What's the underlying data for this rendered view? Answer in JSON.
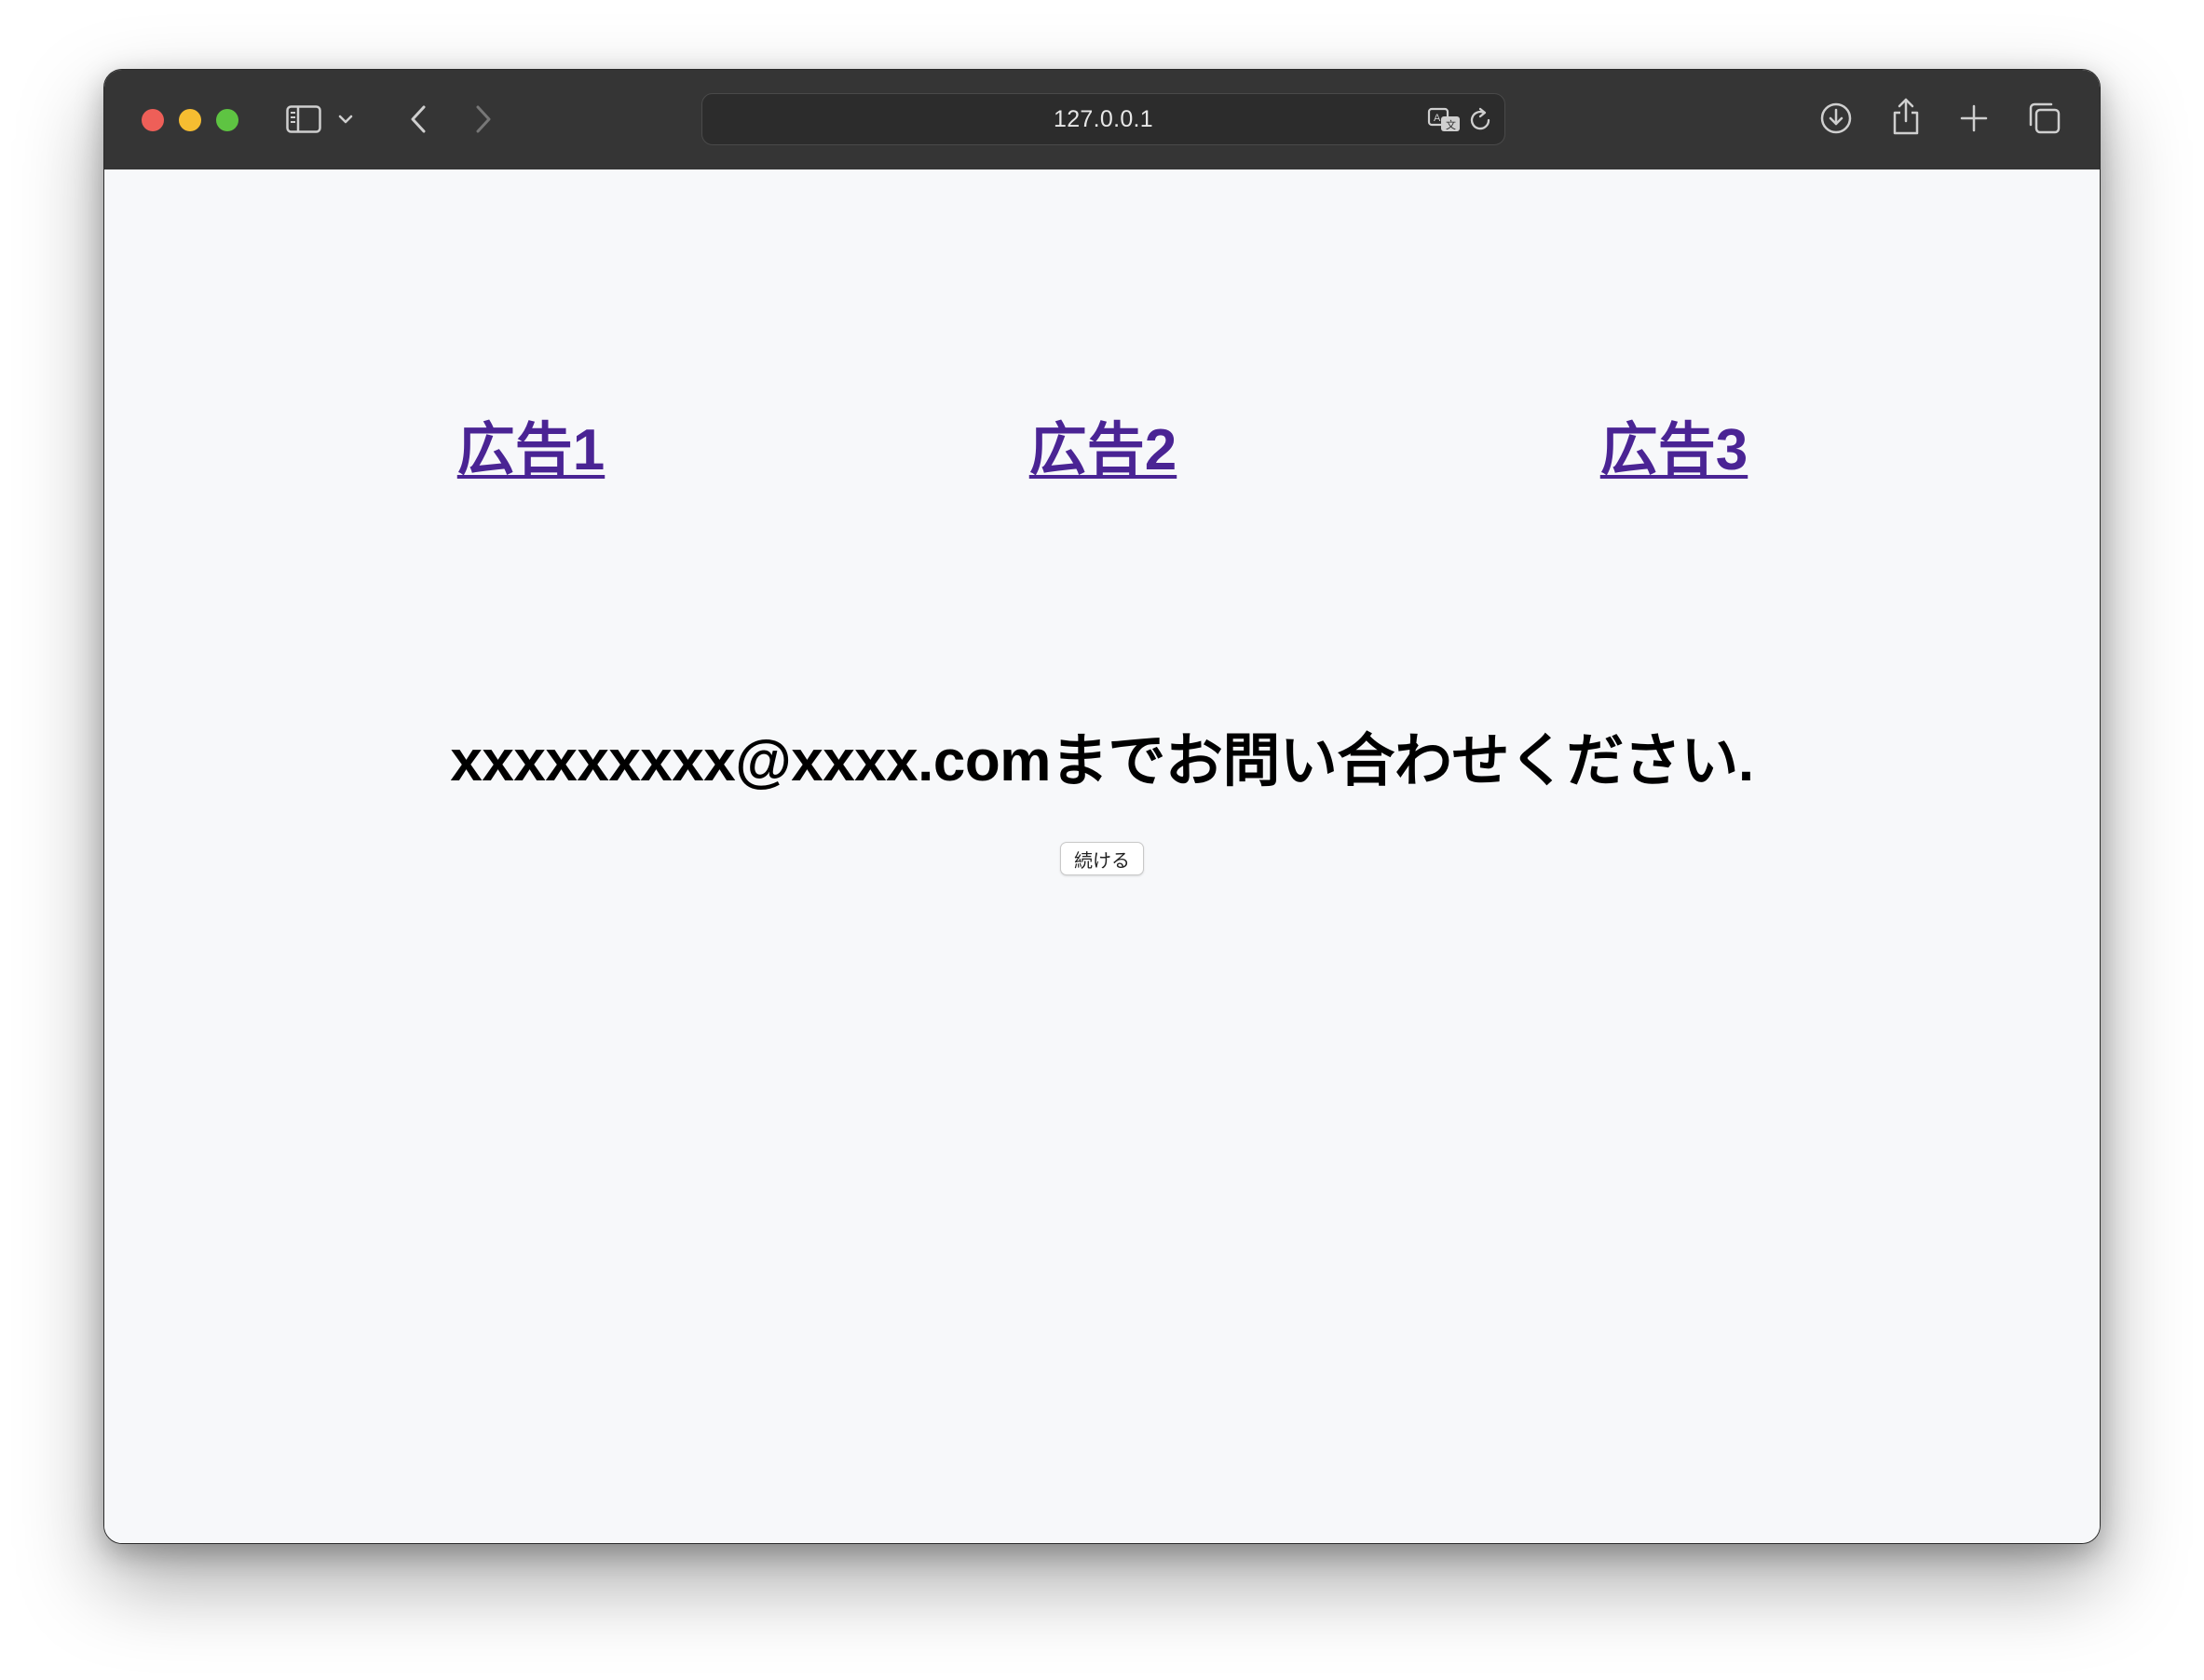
{
  "browser": {
    "url": "127.0.0.1",
    "icons": {
      "sidebar": "sidebar-icon",
      "tab_group_menu": "chevron-down-icon",
      "back": "chevron-left-icon",
      "forward": "chevron-right-icon",
      "translate": "translate-icon",
      "reload": "reload-icon",
      "downloads": "download-icon",
      "share": "share-icon",
      "new_tab": "plus-icon",
      "tab_overview": "tabs-overview-icon"
    }
  },
  "page": {
    "ads": [
      "広告1",
      "広告2",
      "広告3"
    ],
    "contact_text": "xxxxxxxxx@xxxx.comまでお問い合わせください.",
    "continue_button": "続ける"
  },
  "colors": {
    "link": "#4a2494",
    "page_background": "#f7f8fa",
    "toolbar": "#353535"
  }
}
